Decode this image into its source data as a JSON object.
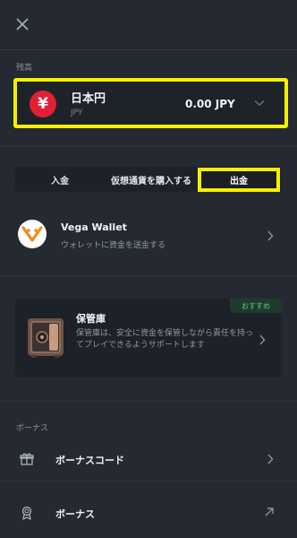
{
  "header": {
    "close_icon": "close-icon"
  },
  "balance_section": {
    "label": "残高",
    "currency_name": "日本円",
    "currency_code": "JPY",
    "currency_symbol": "¥",
    "amount": "0.00 JPY"
  },
  "tabs": [
    {
      "label": "入金"
    },
    {
      "label": "仮想通貨を購入する"
    },
    {
      "label": "出金",
      "active": true
    }
  ],
  "wallet": {
    "title": "Vega Wallet",
    "subtitle": "ウォレットに資金を送金する"
  },
  "vault": {
    "badge": "おすすめ",
    "title": "保管庫",
    "description": "保管庫は、安全に資金を保管しながら責任を持ってプレイできるようサポートします"
  },
  "bonus_section": {
    "label": "ボーナス",
    "items": [
      {
        "label": "ボーナスコード",
        "icon": "gift-icon",
        "action_icon": "chevron-right-icon"
      },
      {
        "label": "ボーナス",
        "icon": "medal-icon",
        "action_icon": "external-arrow-icon"
      }
    ]
  },
  "colors": {
    "background": "#252a32",
    "card": "#1d2128",
    "highlight": "#f4f000",
    "yen_red": "#e21f35",
    "badge_green": "#5ecb8b"
  }
}
